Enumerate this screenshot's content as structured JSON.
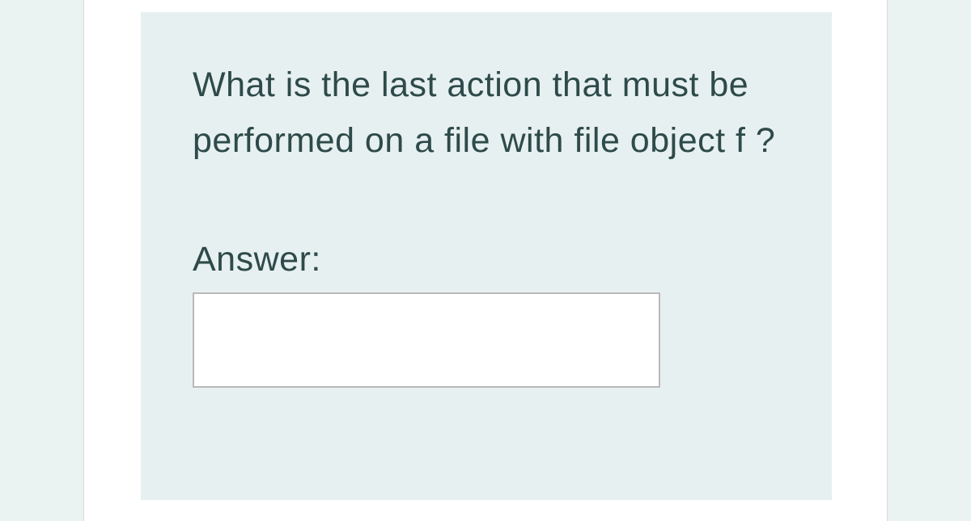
{
  "question": {
    "prompt": "What is the last action that must be performed on a file with file object f ?",
    "answer_label": "Answer:",
    "answer_value": ""
  }
}
